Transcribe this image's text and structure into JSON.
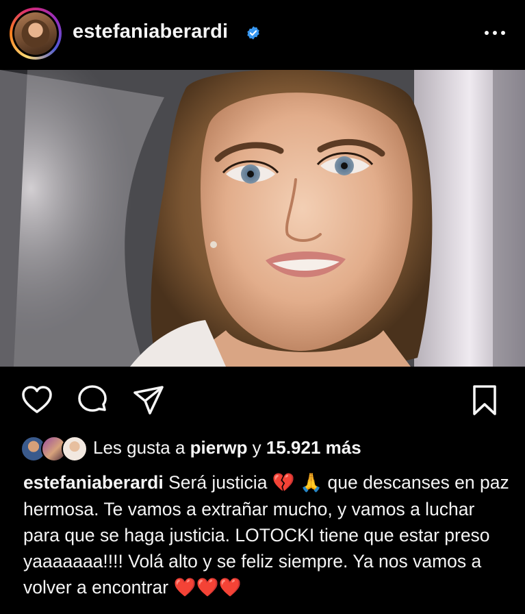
{
  "header": {
    "username": "estefaniaberardi",
    "verified_icon": "verified-badge-icon",
    "more_icon": "more-options-icon"
  },
  "post": {
    "image_alt": "Portrait photo",
    "actions": {
      "like_icon": "heart-icon",
      "comment_icon": "comment-icon",
      "share_icon": "send-icon",
      "save_icon": "bookmark-icon"
    },
    "likes": {
      "prefix": "Les gusta a ",
      "user": "pierwp",
      "middle": " y ",
      "count": "15.921 más"
    },
    "caption": {
      "username": "estefaniaberardi",
      "text_1": " Será justicia ",
      "emoji_1": "💔",
      "emoji_2": "🙏",
      "text_2": " que descanses en paz hermosa. Te vamos a extrañar mucho, y vamos a luchar para que se haga justicia. LOTOCKI tiene que estar preso yaaaaaaa!!!! Volá alto y se feliz siempre. Ya nos vamos a volver a encontrar ",
      "emoji_hearts": "❤️❤️❤️"
    }
  },
  "colors": {
    "background": "#000000",
    "text": "#f5f5f5",
    "verified": "#3897f0",
    "heart_red": "#e0263a"
  }
}
